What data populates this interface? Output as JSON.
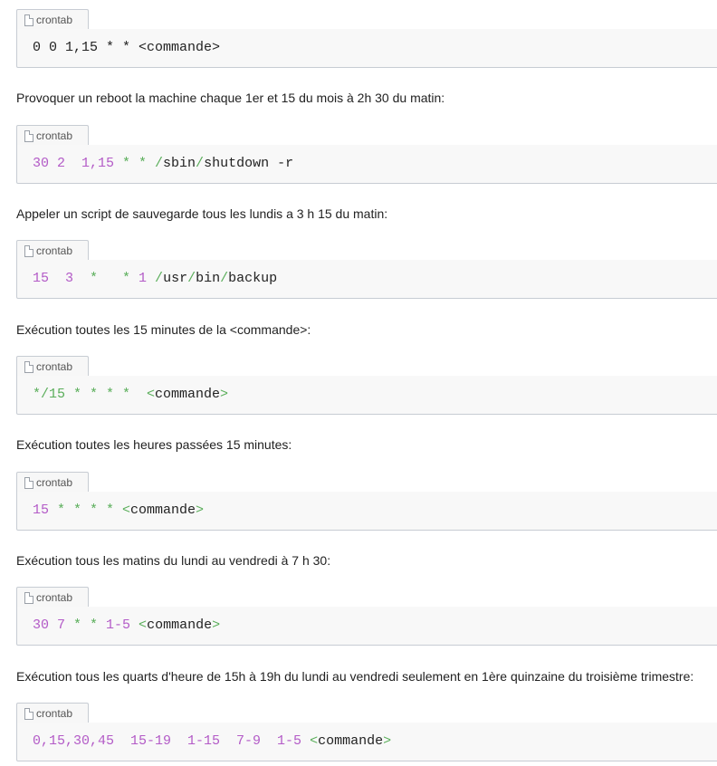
{
  "sections": [
    {
      "description": null,
      "tab_label": "crontab",
      "tokens": [
        {
          "t": "0 0 1,15 * * <commande>",
          "c": "plain"
        }
      ]
    },
    {
      "description": "Provoquer un reboot la machine chaque 1er et 15 du mois à 2h 30 du matin:",
      "tab_label": "crontab",
      "tokens": [
        {
          "t": "30 2  1,15",
          "c": "num"
        },
        {
          "t": " * * /",
          "c": "op"
        },
        {
          "t": "sbin",
          "c": "plain"
        },
        {
          "t": "/",
          "c": "op"
        },
        {
          "t": "shutdown -r",
          "c": "plain"
        }
      ]
    },
    {
      "description": "Appeler un script de sauvegarde tous les lundis a 3 h 15 du matin:",
      "tab_label": "crontab",
      "tokens": [
        {
          "t": "15  3",
          "c": "num"
        },
        {
          "t": "  *   * ",
          "c": "op"
        },
        {
          "t": "1",
          "c": "num"
        },
        {
          "t": " /",
          "c": "op"
        },
        {
          "t": "usr",
          "c": "plain"
        },
        {
          "t": "/",
          "c": "op"
        },
        {
          "t": "bin",
          "c": "plain"
        },
        {
          "t": "/",
          "c": "op"
        },
        {
          "t": "backup",
          "c": "plain"
        }
      ]
    },
    {
      "description": "Exécution toutes les 15 minutes de la <commande>:",
      "tab_label": "crontab",
      "tokens": [
        {
          "t": "*/15 * * * *  <",
          "c": "op"
        },
        {
          "t": "commande",
          "c": "plain"
        },
        {
          "t": ">",
          "c": "op"
        }
      ]
    },
    {
      "description": "Exécution toutes les heures passées 15 minutes:",
      "tab_label": "crontab",
      "tokens": [
        {
          "t": "15",
          "c": "num"
        },
        {
          "t": " * * * * <",
          "c": "op"
        },
        {
          "t": "commande",
          "c": "plain"
        },
        {
          "t": ">",
          "c": "op"
        }
      ]
    },
    {
      "description": "Exécution tous les matins du lundi au vendredi à 7 h 30:",
      "tab_label": "crontab",
      "tokens": [
        {
          "t": "30 7",
          "c": "num"
        },
        {
          "t": " * * ",
          "c": "op"
        },
        {
          "t": "1-5",
          "c": "num"
        },
        {
          "t": " <",
          "c": "op"
        },
        {
          "t": "commande",
          "c": "plain"
        },
        {
          "t": ">",
          "c": "op"
        }
      ]
    },
    {
      "description": "Exécution tous les quarts d'heure de 15h à 19h du lundi au vendredi seulement en 1ère quinzaine du troisième trimestre:",
      "tab_label": "crontab",
      "tokens": [
        {
          "t": "0,15,30,45  15-19  1-15  7-9  1-5",
          "c": "num"
        },
        {
          "t": " <",
          "c": "op"
        },
        {
          "t": "commande",
          "c": "plain"
        },
        {
          "t": ">",
          "c": "op"
        }
      ]
    }
  ],
  "colors": {
    "number": "#b35bc7",
    "operator": "#5aae5a",
    "plain": "#222222",
    "box_background": "#f8f8f8",
    "border": "#c7ccd3"
  },
  "icons": {
    "tab_icon": "file-icon"
  }
}
